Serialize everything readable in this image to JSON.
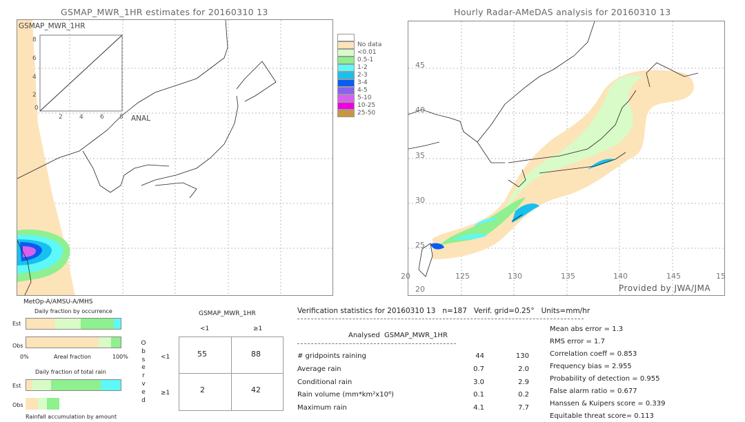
{
  "left_map": {
    "title": "GSMAP_MWR_1HR estimates for 20160310 13",
    "inset_label": "GSMAP_MWR_1HR",
    "inset_xlabel": "ANAL",
    "inset_ticks": [
      "0",
      "2",
      "4",
      "6",
      "8"
    ],
    "satellite": "MetOp-A/AMSU-A/MHS"
  },
  "right_map": {
    "title": "Hourly Radar-AMeDAS analysis for 20160310 13",
    "lat_labels": [
      "45",
      "40",
      "35",
      "30",
      "25",
      "20"
    ],
    "lon_labels": [
      "20",
      "125",
      "130",
      "135",
      "140",
      "145",
      "15"
    ],
    "credit": "Provided by JWA/JMA"
  },
  "legend": [
    {
      "label": "",
      "color": "#ffffff"
    },
    {
      "label": "No data",
      "color": "#fde3b8"
    },
    {
      "label": "<0.01",
      "color": "#d8fbc8"
    },
    {
      "label": "0.5-1",
      "color": "#8ef08e"
    },
    {
      "label": "1-2",
      "color": "#5ef8f8"
    },
    {
      "label": "2-3",
      "color": "#18c0f0"
    },
    {
      "label": "3-4",
      "color": "#0a5cf0"
    },
    {
      "label": "4-5",
      "color": "#8a62f0"
    },
    {
      "label": "5-10",
      "color": "#d860f0"
    },
    {
      "label": "10-25",
      "color": "#f000e0"
    },
    {
      "label": "25-50",
      "color": "#c89640"
    }
  ],
  "fraction": {
    "occurrence_title": "Daily fraction by occurrence",
    "est_label": "Est",
    "obs_label": "Obs",
    "axis_left": "0%",
    "axis_mid": "Areal fraction",
    "axis_right": "100%",
    "total_title": "Daily fraction of total rain",
    "accum_title": "Rainfall accumulation by amount",
    "occurrence_est_pct": [
      31,
      27,
      35,
      7
    ],
    "occurrence_obs_pct": [
      77,
      13,
      10
    ],
    "total_est_pct": [
      6,
      20,
      53,
      21
    ],
    "total_obs_pct": [
      13,
      9,
      13
    ]
  },
  "contingency": {
    "header": "GSMAP_MWR_1HR",
    "col_labels": [
      "<1",
      "≥1"
    ],
    "row_labels": [
      "<1",
      "≥1"
    ],
    "side_label": [
      "O",
      "b",
      "s",
      "e",
      "r",
      "v",
      "e",
      "d"
    ],
    "cells": [
      [
        "55",
        "88"
      ],
      [
        "2",
        "42"
      ]
    ]
  },
  "stats": {
    "title": "Verification statistics for 20160310 13   n=187   Verif. grid=0.25°   Units=mm/hr",
    "col_analysed": "Analysed",
    "col_est": "GSMAP_MWR_1HR",
    "rows": [
      {
        "label": "# gridpoints raining",
        "analysed": "44",
        "est": "130"
      },
      {
        "label": "Average rain",
        "analysed": "0.7",
        "est": "2.0"
      },
      {
        "label": "Conditional rain",
        "analysed": "3.0",
        "est": "2.9"
      },
      {
        "label": "Rain volume (mm*km²x10⁶)",
        "analysed": "0.1",
        "est": "0.2"
      },
      {
        "label": "Maximum rain",
        "analysed": "4.1",
        "est": "7.7"
      }
    ],
    "scores": [
      "Mean abs error = 1.3",
      "RMS error = 1.7",
      "Correlation coeff = 0.853",
      "Frequency bias = 2.955",
      "Probability of detection = 0.955",
      "False alarm ratio = 0.677",
      "Hanssen & Kuipers score = 0.339",
      "Equitable threat score= 0.113"
    ]
  }
}
